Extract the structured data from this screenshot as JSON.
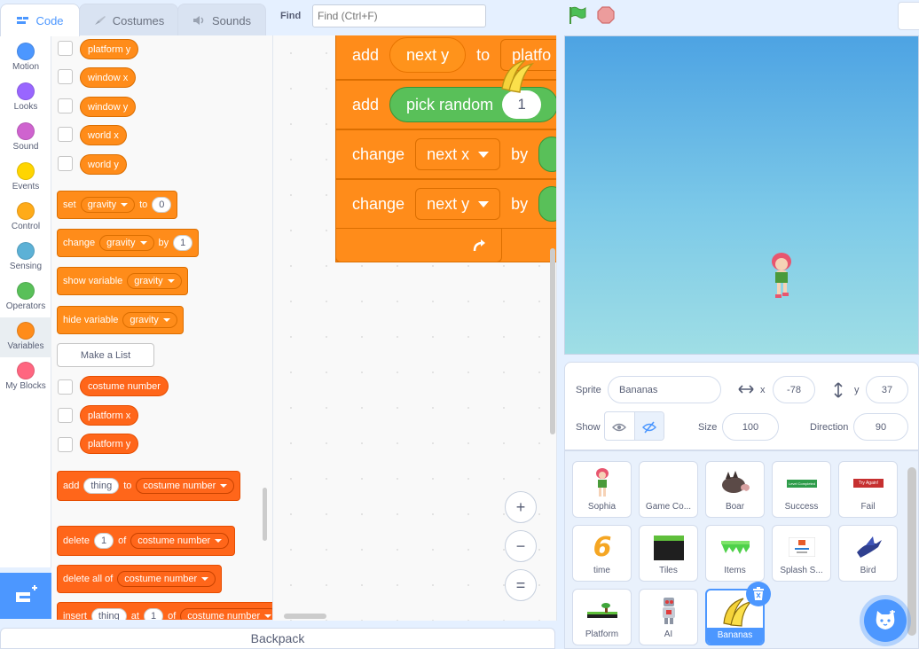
{
  "tabs": {
    "code": "Code",
    "costumes": "Costumes",
    "sounds": "Sounds"
  },
  "find": {
    "label": "Find",
    "placeholder": "Find (Ctrl+F)"
  },
  "categories": [
    {
      "label": "Motion",
      "color": "#4c97ff"
    },
    {
      "label": "Looks",
      "color": "#9966ff"
    },
    {
      "label": "Sound",
      "color": "#cf63cf"
    },
    {
      "label": "Events",
      "color": "#ffd500"
    },
    {
      "label": "Control",
      "color": "#ffab19"
    },
    {
      "label": "Sensing",
      "color": "#5cb1d6"
    },
    {
      "label": "Operators",
      "color": "#59c059"
    },
    {
      "label": "Variables",
      "color": "#ff8c1a"
    },
    {
      "label": "My Blocks",
      "color": "#ff6680"
    }
  ],
  "palette": {
    "reporters_top": [
      "platform y",
      "window x",
      "window y",
      "world x",
      "world y"
    ],
    "set_block": {
      "set": "set",
      "var": "gravity",
      "to": "to",
      "value": "0"
    },
    "change_block": {
      "change": "change",
      "var": "gravity",
      "by": "by",
      "value": "1"
    },
    "show_block": {
      "label": "show variable",
      "var": "gravity"
    },
    "hide_block": {
      "label": "hide variable",
      "var": "gravity"
    },
    "make_list": "Make a List",
    "list_reporters": [
      "costume number",
      "platform x",
      "platform y"
    ],
    "add_block": {
      "add": "add",
      "item": "thing",
      "to": "to",
      "list": "costume number"
    },
    "delete_block": {
      "delete": "delete",
      "value": "1",
      "of": "of",
      "list": "costume number"
    },
    "delete_all_block": {
      "label": "delete all of",
      "list": "costume number"
    },
    "insert_block": {
      "insert": "insert",
      "item": "thing",
      "at": "at",
      "value": "1",
      "of": "of",
      "list": "costume number"
    }
  },
  "script": {
    "b1": {
      "op": "add",
      "var": "next y",
      "to": "to",
      "list": "platfo"
    },
    "b2": {
      "op": "add",
      "fn": "pick random",
      "value": "1"
    },
    "b3": {
      "op": "change",
      "var": "next x",
      "by": "by"
    },
    "b4": {
      "op": "change",
      "var": "next y",
      "by": "by"
    }
  },
  "zoom": {
    "in": "+",
    "out": "−",
    "reset": "="
  },
  "backpack": "Backpack",
  "sprite_info": {
    "sprite_label": "Sprite",
    "sprite_name": "Bananas",
    "x_label": "x",
    "x_value": "-78",
    "y_label": "y",
    "y_value": "37",
    "show_label": "Show",
    "size_label": "Size",
    "size_value": "100",
    "direction_label": "Direction",
    "direction_value": "90"
  },
  "sprites": [
    {
      "name": "Sophia",
      "thumb": "girl"
    },
    {
      "name": "Game Co...",
      "thumb": "blank"
    },
    {
      "name": "Boar",
      "thumb": "boar"
    },
    {
      "name": "Success",
      "thumb": "banner-green",
      "text": "Level Completed"
    },
    {
      "name": "Fail",
      "thumb": "banner-red",
      "text": "Try Again!"
    },
    {
      "name": "time",
      "thumb": "digit",
      "text": "6"
    },
    {
      "name": "Tiles",
      "thumb": "tiles"
    },
    {
      "name": "Items",
      "thumb": "grass"
    },
    {
      "name": "Splash S...",
      "thumb": "splash"
    },
    {
      "name": "Bird",
      "thumb": "bird"
    },
    {
      "name": "Platform",
      "thumb": "platform"
    },
    {
      "name": "AI",
      "thumb": "robot"
    },
    {
      "name": "Bananas",
      "thumb": "bananas",
      "selected": true
    }
  ],
  "colors": {
    "accent": "#4c97ff",
    "variables": "#ff8c1a",
    "lists": "#ff661a",
    "operators": "#59c059"
  }
}
